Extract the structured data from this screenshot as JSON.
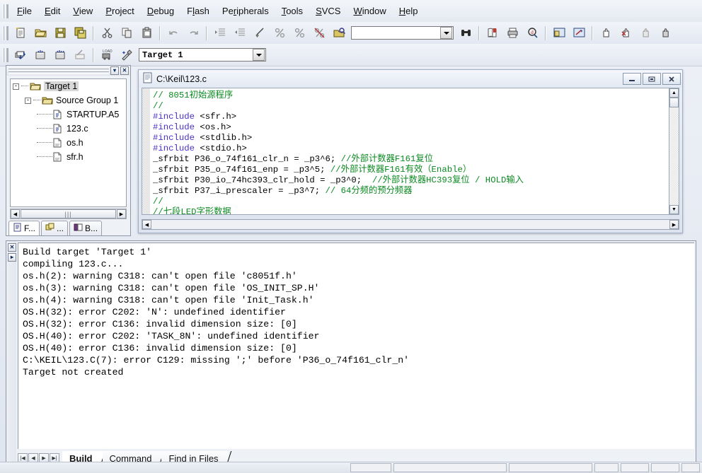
{
  "menu": {
    "items": [
      {
        "label": "File",
        "acc": "F"
      },
      {
        "label": "Edit",
        "acc": "E"
      },
      {
        "label": "View",
        "acc": "V"
      },
      {
        "label": "Project",
        "acc": "P"
      },
      {
        "label": "Debug",
        "acc": "D"
      },
      {
        "label": "Flash",
        "acc": "l"
      },
      {
        "label": "Peripherals",
        "acc": "r"
      },
      {
        "label": "Tools",
        "acc": "T"
      },
      {
        "label": "SVCS",
        "acc": "S"
      },
      {
        "label": "Window",
        "acc": "W"
      },
      {
        "label": "Help",
        "acc": "H"
      }
    ]
  },
  "toolbar_main": {
    "buttons": [
      {
        "name": "new-file-icon",
        "title": "New"
      },
      {
        "name": "open-file-icon",
        "title": "Open"
      },
      {
        "name": "save-icon",
        "title": "Save"
      },
      {
        "name": "save-all-icon",
        "title": "Save All"
      },
      {
        "name": "cut-icon",
        "title": "Cut"
      },
      {
        "name": "copy-icon",
        "title": "Copy"
      },
      {
        "name": "paste-icon",
        "title": "Paste"
      },
      {
        "name": "undo-icon",
        "title": "Undo"
      },
      {
        "name": "redo-icon",
        "title": "Redo"
      },
      {
        "name": "indent-icon",
        "title": "Indent Selected Text"
      },
      {
        "name": "outdent-icon",
        "title": "Unindent Selected Text"
      },
      {
        "name": "toggle-bookmark-icon",
        "title": "Insert/Remove Bookmark"
      },
      {
        "name": "prev-bookmark-icon",
        "title": "Go to Previous Bookmark"
      },
      {
        "name": "next-bookmark-icon",
        "title": "Go to Next Bookmark"
      },
      {
        "name": "clear-bookmarks-icon",
        "title": "Clear All Bookmarks"
      },
      {
        "name": "find-in-files-icon",
        "title": "Find in Files"
      }
    ],
    "find_placeholder": "",
    "find_value": "",
    "buttons_right": [
      {
        "name": "binoculars-find-icon",
        "title": "Find"
      },
      {
        "name": "bookmark-list-icon",
        "title": "Browse"
      },
      {
        "name": "print-icon",
        "title": "Print"
      },
      {
        "name": "find-target-icon",
        "title": "Find Target"
      },
      {
        "name": "project-window-icon",
        "title": "Project Window"
      },
      {
        "name": "output-window-icon",
        "title": "Output Window"
      },
      {
        "name": "hand-icon",
        "title": "Debug"
      },
      {
        "name": "hand-stop-icon",
        "title": "Stop"
      },
      {
        "name": "hand-disabled-icon",
        "title": "Insert/Remove"
      },
      {
        "name": "hand-active-icon",
        "title": "Kill All"
      }
    ]
  },
  "toolbar_build": {
    "buttons": [
      {
        "name": "translate-icon",
        "title": "Translate current file"
      },
      {
        "name": "build-target-icon",
        "title": "Build target"
      },
      {
        "name": "rebuild-all-icon",
        "title": "Rebuild all target files"
      },
      {
        "name": "stop-build-icon",
        "title": "Stop build"
      },
      {
        "name": "download-icon",
        "title": "Download to Flash Memory"
      },
      {
        "name": "target-options-icon",
        "title": "Options for Target"
      }
    ],
    "target_selected": "Target 1"
  },
  "project_pane": {
    "dropdown_icon": "chevron-down-icon",
    "close_icon": "close-icon",
    "tree": [
      {
        "level": 0,
        "label": "Target 1",
        "icon": "target-folder-icon",
        "toggle": "-",
        "selected": true
      },
      {
        "level": 1,
        "label": "Source Group 1",
        "icon": "source-group-folder-icon",
        "toggle": "-",
        "selected": false
      },
      {
        "level": 2,
        "label": "STARTUP.A5",
        "icon": "asm-file-icon",
        "toggle": "",
        "selected": false
      },
      {
        "level": 2,
        "label": "123.c",
        "icon": "c-file-icon",
        "toggle": "",
        "selected": false
      },
      {
        "level": 2,
        "label": "os.h",
        "icon": "header-file-icon",
        "toggle": "",
        "selected": false
      },
      {
        "level": 2,
        "label": "sfr.h",
        "icon": "header-file-icon",
        "toggle": "",
        "selected": false
      }
    ],
    "tabs": [
      {
        "label": "F...",
        "icon": "files-icon",
        "active": true
      },
      {
        "label": "...",
        "icon": "regs-icon",
        "active": false
      },
      {
        "label": "B...",
        "icon": "books-icon",
        "active": false
      }
    ],
    "hscroll_grip": "|||"
  },
  "editor": {
    "title": "C:\\Keil\\123.c",
    "doc_icon": "document-icon",
    "minimize_label": "_",
    "restore_label": "❐",
    "close_label": "✕",
    "lines": [
      [
        {
          "t": "// 8051初始源程序",
          "c": "cm"
        }
      ],
      [
        {
          "t": "//",
          "c": "cm"
        }
      ],
      [
        {
          "t": "#include",
          "c": "pp"
        },
        {
          "t": " <sfr.h>",
          "c": "tx"
        }
      ],
      [
        {
          "t": "#include",
          "c": "pp"
        },
        {
          "t": " <os.h>",
          "c": "tx"
        }
      ],
      [
        {
          "t": "#include",
          "c": "pp"
        },
        {
          "t": " <stdlib.h>",
          "c": "tx"
        }
      ],
      [
        {
          "t": "#include",
          "c": "pp"
        },
        {
          "t": " <stdio.h>",
          "c": "tx"
        }
      ],
      [
        {
          "t": "_sfrbit P36_o_74f161_clr_n = _p3^6; ",
          "c": "tx"
        },
        {
          "t": "//外部计数器F161复位",
          "c": "cm"
        }
      ],
      [
        {
          "t": "_sfrbit P35_o_74f161_enp = _p3^5; ",
          "c": "tx"
        },
        {
          "t": "//外部计数器F161有效（Enable）",
          "c": "cm"
        }
      ],
      [
        {
          "t": "_sfrbit P30_io_74hc393_clr_hold = _p3^0;  ",
          "c": "tx"
        },
        {
          "t": "//外部计数器HC393复位 / HOLD输入",
          "c": "cm"
        }
      ],
      [
        {
          "t": "_sfrbit P37_i_prescaler = _p3^7; ",
          "c": "tx"
        },
        {
          "t": "// 64分频的预分频器",
          "c": "cm"
        }
      ],
      [
        {
          "t": "//",
          "c": "cm"
        }
      ],
      [
        {
          "t": "//七段LED字形数据",
          "c": "cm"
        }
      ]
    ]
  },
  "output": {
    "close_icon": "close-icon",
    "expand_icon": "expand-icon",
    "text": "Build target 'Target 1'\ncompiling 123.c...\nos.h(2): warning C318: can't open file 'c8051f.h'\nos.h(3): warning C318: can't open file 'OS_INIT_SP.H'\nos.h(4): warning C318: can't open file 'Init_Task.h'\nOS.H(32): error C202: 'N': undefined identifier\nOS.H(32): error C136: invalid dimension size: [0]\nOS.H(40): error C202: 'TASK_8N': undefined identifier\nOS.H(40): error C136: invalid dimension size: [0]\nC:\\KEIL\\123.C(7): error C129: missing ';' before 'P36_o_74f161_clr_n'\nTarget not created",
    "nav_buttons": [
      {
        "name": "first-tab-button",
        "glyph": "|◀"
      },
      {
        "name": "prev-tab-button",
        "glyph": "◀"
      },
      {
        "name": "next-tab-button",
        "glyph": "▶"
      },
      {
        "name": "last-tab-button",
        "glyph": "▶|"
      }
    ],
    "tabs": [
      {
        "label": "Build",
        "active": true
      },
      {
        "label": "Command",
        "active": false
      },
      {
        "label": "Find in Files",
        "active": false
      }
    ]
  },
  "status_bar": {
    "message": "",
    "cells": [
      "",
      "",
      "",
      "",
      "",
      ""
    ]
  },
  "colors": {
    "comment": "#0c8a22",
    "preprocessor": "#4a30c8",
    "code": "#000000",
    "window_bg": "#d6dce8",
    "panel_bg": "#eef1f6"
  }
}
